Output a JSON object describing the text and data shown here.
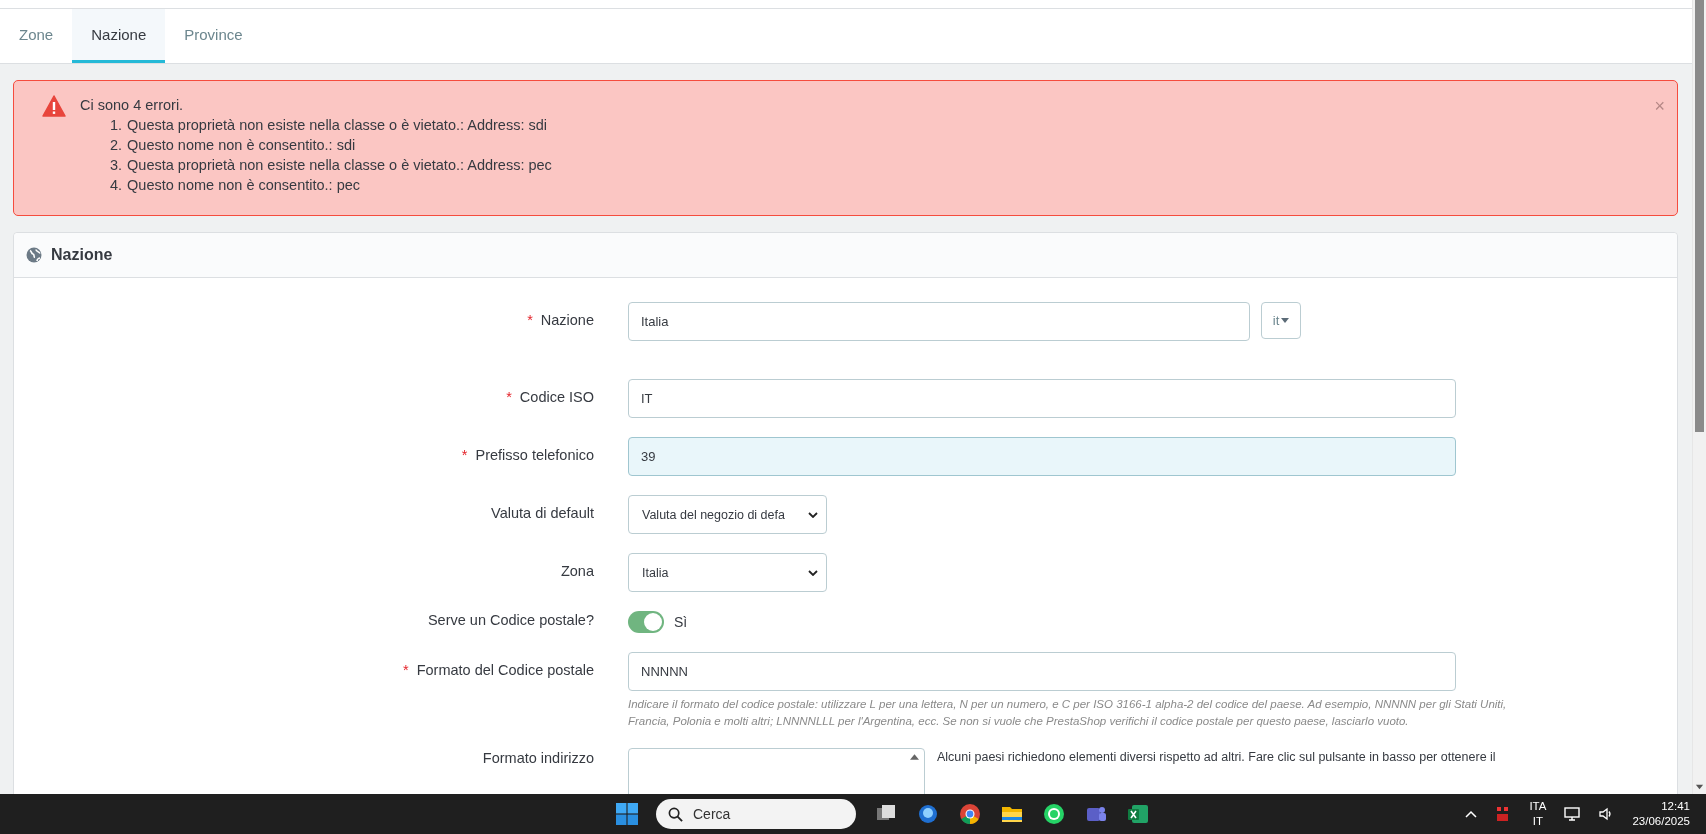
{
  "tabs": [
    {
      "label": "Zone",
      "selected": false
    },
    {
      "label": "Nazione",
      "selected": true
    },
    {
      "label": "Province",
      "selected": false
    }
  ],
  "alert": {
    "title": "Ci sono 4 errori.",
    "close": "×",
    "errors": [
      {
        "number": "1.",
        "text": "Questa proprietà non esiste nella classe o è vietato.: Address: sdi"
      },
      {
        "number": "2.",
        "text": "Questo nome non è consentito.: sdi"
      },
      {
        "number": "3.",
        "text": "Questa proprietà non esiste nella classe o è vietato.: Address: pec"
      },
      {
        "number": "4.",
        "text": "Questo nome non è consentito.: pec"
      }
    ]
  },
  "panel": {
    "title": "Nazione",
    "fields": [
      {
        "kind": "text",
        "label": "Nazione",
        "required_mark": "*",
        "value": "Italia",
        "language": "it",
        "focused": false
      },
      {
        "kind": "text",
        "label": "Codice ISO",
        "required_mark": "*",
        "value": "IT",
        "focused": false
      },
      {
        "kind": "text",
        "label": "Prefisso telefonico",
        "required_mark": "*",
        "value": "39",
        "focused": true
      },
      {
        "kind": "select",
        "label": "Valuta di default",
        "value": "Valuta del negozio di defa"
      },
      {
        "kind": "select",
        "label": "Zona",
        "value": "Italia"
      },
      {
        "kind": "toggle",
        "label": "Serve un Codice postale?",
        "on": true,
        "state_label": "Sì"
      },
      {
        "kind": "text",
        "label": "Formato del Codice postale",
        "required_mark": "*",
        "value": "NNNNN",
        "focused": false,
        "help": "Indicare il formato del codice postale: utilizzare L per una lettera, N per un numero, e C per ISO 3166-1 alpha-2 del codice del paese. Ad esempio, NNNNN per gli Stati Uniti, Francia, Polonia e molti altri; LNNNNLLL per l'Argentina, ecc. Se non si vuole che PrestaShop verifichi il codice postale per questo paese, lasciarlo vuoto."
      },
      {
        "kind": "textarea",
        "label": "Formato indirizzo",
        "side_help": "Alcuni paesi richiedono elementi diversi rispetto ad altri. Fare clic sul pulsante in basso per ottenere il"
      }
    ]
  },
  "taskbar": {
    "search_placeholder": "Cerca",
    "language": "ITA",
    "layout": "IT",
    "time": "12:41",
    "date": "23/06/2025"
  }
}
